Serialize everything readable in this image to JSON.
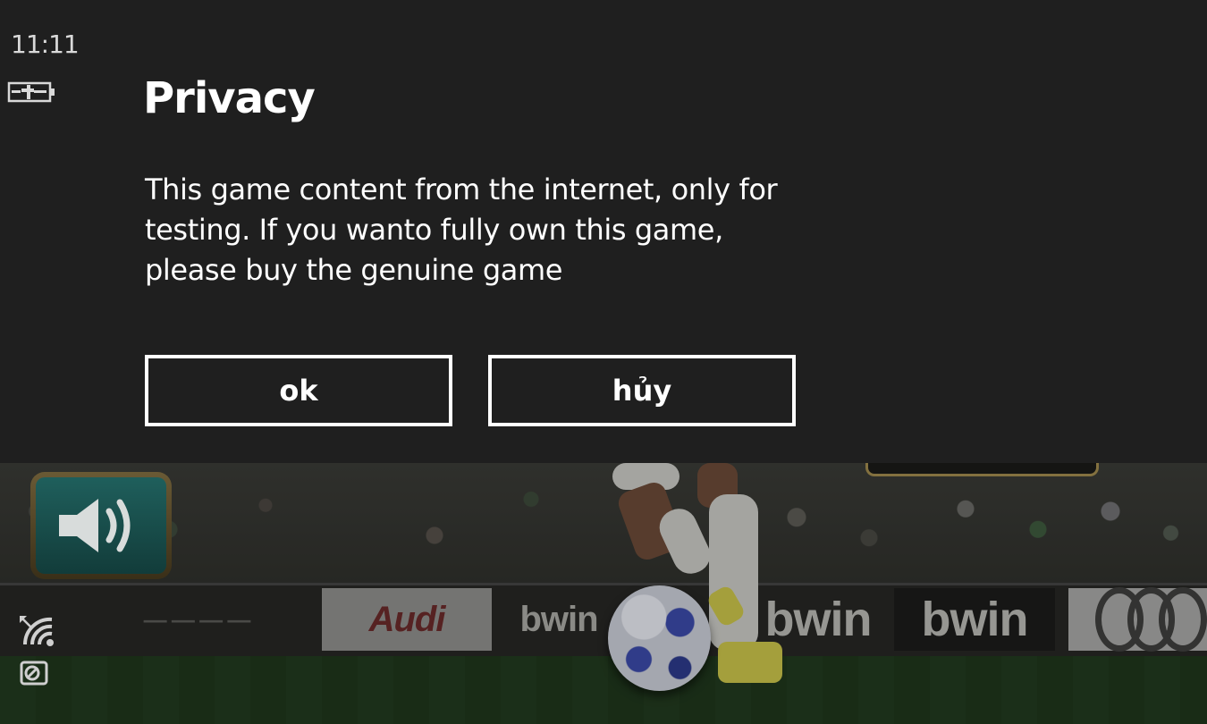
{
  "status_bar": {
    "time": "11:11",
    "battery_icon": "battery-charging-icon",
    "wifi_icon": "wifi-icon",
    "data_icon": "data-sense-icon"
  },
  "dialog": {
    "title": "Privacy",
    "message": "This game content from the internet, only for testing. If you wanto fully own this game, please buy the genuine game",
    "ok_label": "ok",
    "cancel_label": "hủy"
  },
  "game": {
    "sound_icon": "speaker-icon",
    "ads": [
      "Audi",
      "bwin",
      "bwin",
      "bwin"
    ]
  },
  "colors": {
    "dialog_background": "#1f1f1f",
    "text": "#ffffff",
    "button_border": "#ffffff"
  }
}
